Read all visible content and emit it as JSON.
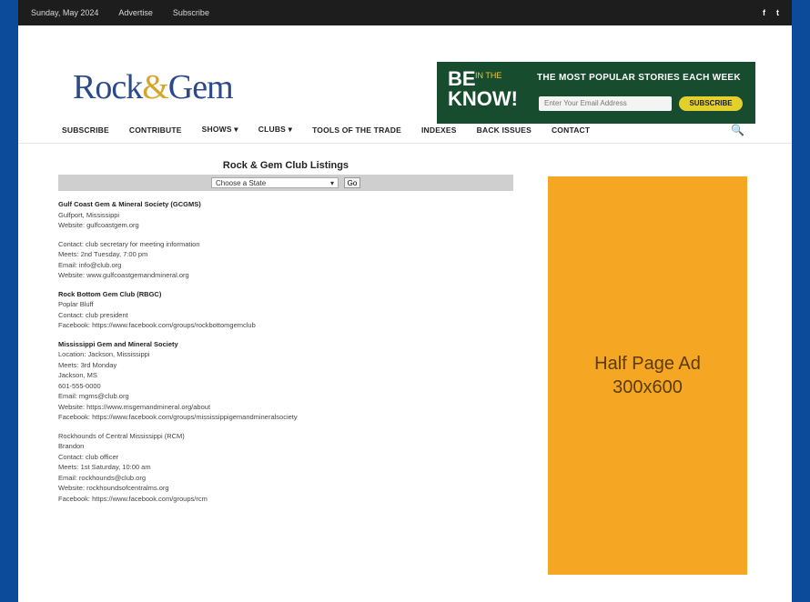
{
  "topbar": {
    "links": [
      "Sunday, May 2024",
      "Advertise",
      "Subscribe"
    ],
    "social": [
      "f",
      "t"
    ]
  },
  "brand": {
    "logo_left": "Rock",
    "logo_amp": "&",
    "logo_right": "Gem"
  },
  "banner": {
    "be": "BE",
    "know": "KNOW!",
    "in_the": "IN THE",
    "tagline": "THE MOST POPULAR STORIES EACH WEEK",
    "email_placeholder": "Enter Your Email Address",
    "subscribe_label": "SUBSCRIBE"
  },
  "nav": {
    "items": [
      "SUBSCRIBE",
      "CONTRIBUTE",
      "SHOWS ▾",
      "CLUBS ▾",
      "TOOLS OF THE TRADE",
      "INDEXES",
      "BACK ISSUES",
      "CONTACT"
    ],
    "search_icon": "🔍"
  },
  "listing": {
    "title": "Rock & Gem Club Listings",
    "select_value": "Choose a State",
    "select_arrow": "▾",
    "go_label": "Go"
  },
  "blocks": [
    {
      "lines": [
        {
          "t": "Gulf Coast Gem & Mineral Society (GCGMS)",
          "b": true
        },
        {
          "t": "Gulfport, Mississippi"
        },
        {
          "t": "Website: gulfcoastgem.org"
        }
      ]
    },
    {
      "lines": [
        {
          "t": "Contact: club secretary for meeting information"
        },
        {
          "t": "Meets: 2nd Tuesday, 7:00 pm"
        },
        {
          "t": "Email: info@club.org"
        },
        {
          "t": "Website: www.gulfcoastgemandmineral.org"
        }
      ]
    },
    {
      "lines": [
        {
          "t": "Rock Bottom Gem Club (RBGC)",
          "b": true
        },
        {
          "t": "Poplar Bluff"
        },
        {
          "t": "Contact: club president"
        },
        {
          "t": "Facebook: https://www.facebook.com/groups/rockbottomgemclub"
        }
      ]
    },
    {
      "lines": [
        {
          "t": "Mississippi Gem and Mineral Society",
          "b": true
        },
        {
          "t": "Location: Jackson, Mississippi"
        },
        {
          "t": "Meets: 3rd Monday"
        },
        {
          "t": "Jackson, MS"
        },
        {
          "t": "601-555-0000"
        },
        {
          "t": "Email: mgms@club.org"
        },
        {
          "t": "Website: https://www.msgemandmineral.org/about"
        },
        {
          "t": "Facebook: https://www.facebook.com/groups/mississippigemandmineralsociety"
        }
      ]
    },
    {
      "lines": [
        {
          "t": "Rockhounds of Central Mississippi (RCM)"
        },
        {
          "t": "Brandon"
        },
        {
          "t": "Contact: club officer"
        },
        {
          "t": "Meets: 1st Saturday, 10:00 am"
        },
        {
          "t": "Email: rockhounds@club.org"
        },
        {
          "t": "Website: rockhoundsofcentralms.org"
        },
        {
          "t": "Facebook: https://www.facebook.com/groups/rcm"
        }
      ]
    }
  ],
  "ad": {
    "line1": "Half Page Ad",
    "line2": "300x600"
  }
}
